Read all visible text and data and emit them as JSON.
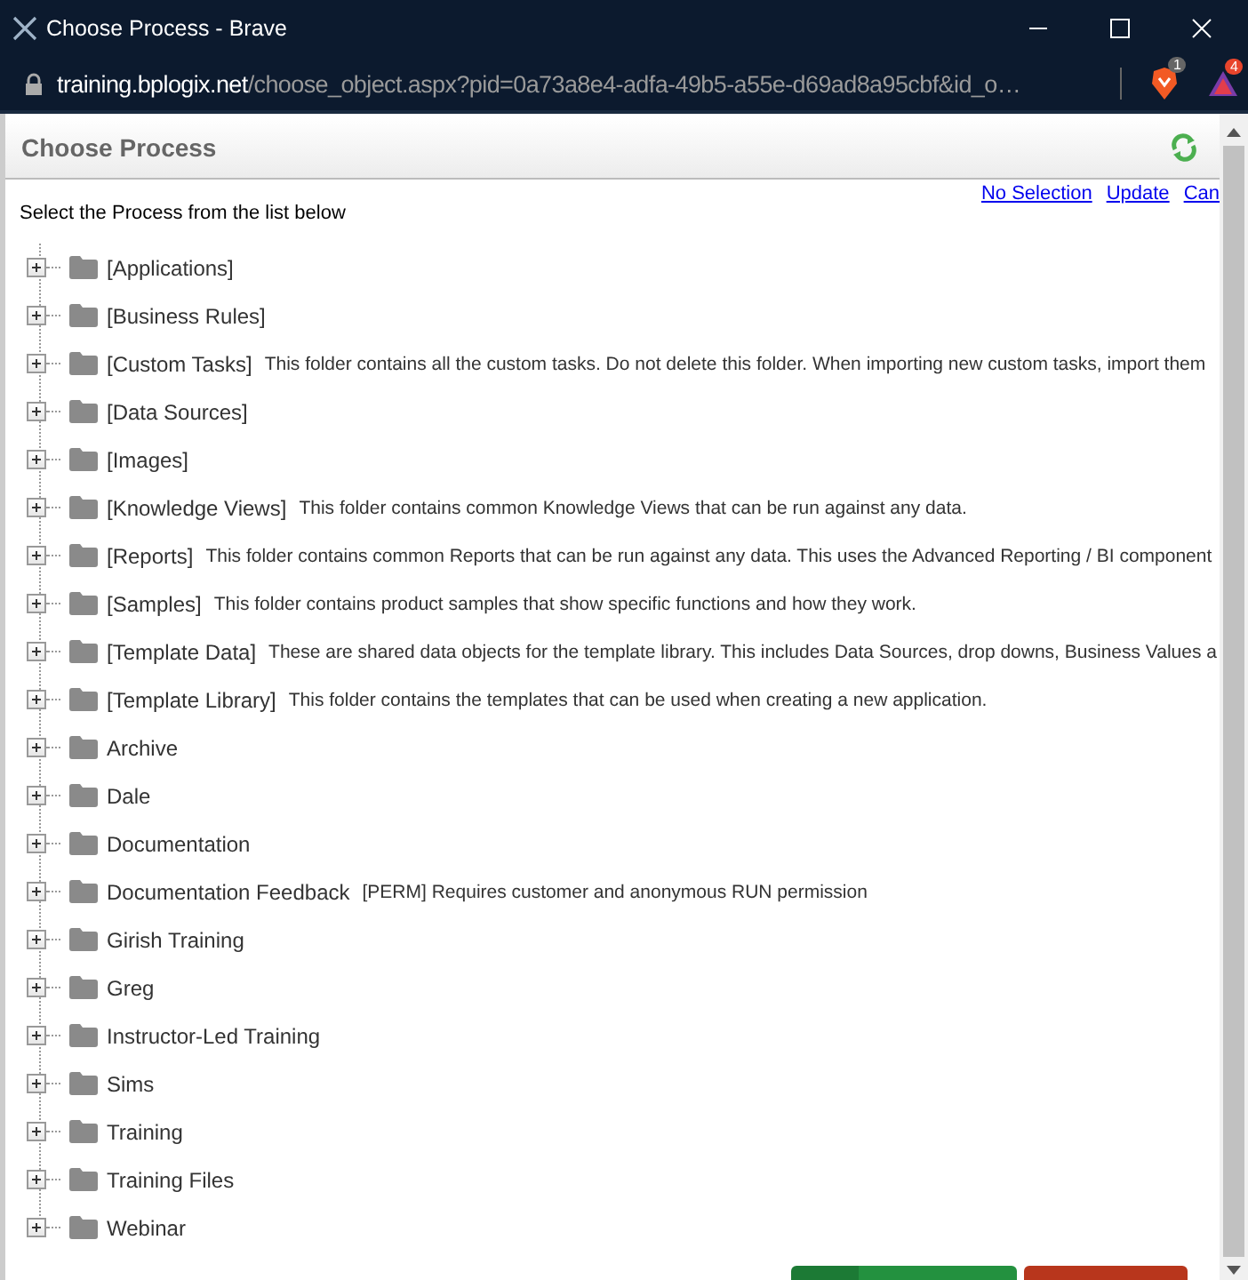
{
  "window": {
    "title": "Choose Process - Brave",
    "address_host": "training.bplogix.net",
    "address_path": "/choose_object.aspx?pid=0a73a8e4-adfa-49b5-a55e-d69ad8a95cbf&id_o…",
    "shields_count": "1",
    "alerts_count": "4"
  },
  "panel": {
    "title": "Choose Process",
    "instruction": "Select the Process from the list below",
    "links": [
      "No Selection",
      "Update",
      "Can"
    ]
  },
  "tree": [
    {
      "name": "[Applications]",
      "expanded": false
    },
    {
      "name": "[Business Rules]",
      "expanded": false
    },
    {
      "name": "[Custom Tasks]",
      "description": "This folder contains all the custom tasks. Do not delete this folder. When importing new custom tasks, import them",
      "expanded": false
    },
    {
      "name": "[Data Sources]",
      "expanded": false
    },
    {
      "name": "[Images]",
      "expanded": false
    },
    {
      "name": "[Knowledge Views]",
      "description": "This folder contains common Knowledge Views that can be run against any data.",
      "expanded": false
    },
    {
      "name": "[Reports]",
      "description": "This folder contains common Reports that can be run against any data. This uses the Advanced Reporting / BI component",
      "expanded": false
    },
    {
      "name": "[Samples]",
      "description": "This folder contains product samples that show specific functions and how they work.",
      "expanded": false
    },
    {
      "name": "[Template Data]",
      "description": "These are shared data objects for the template library. This includes Data Sources, drop downs, Business Values a",
      "expanded": false
    },
    {
      "name": "[Template Library]",
      "description": "This folder contains the templates that can be used when creating a new application.",
      "expanded": false
    },
    {
      "name": "Archive",
      "expanded": false
    },
    {
      "name": "Dale",
      "expanded": false
    },
    {
      "name": "Documentation",
      "expanded": false
    },
    {
      "name": "Documentation Feedback",
      "description": "[PERM] Requires customer and anonymous RUN permission",
      "expanded": false
    },
    {
      "name": "Girish Training",
      "expanded": false
    },
    {
      "name": "Greg",
      "expanded": false
    },
    {
      "name": "Instructor-Led Training",
      "expanded": false
    },
    {
      "name": "Sims",
      "expanded": false
    },
    {
      "name": "Training",
      "expanded": false
    },
    {
      "name": "Training Files",
      "expanded": false
    },
    {
      "name": "Webinar",
      "expanded": false
    }
  ]
}
